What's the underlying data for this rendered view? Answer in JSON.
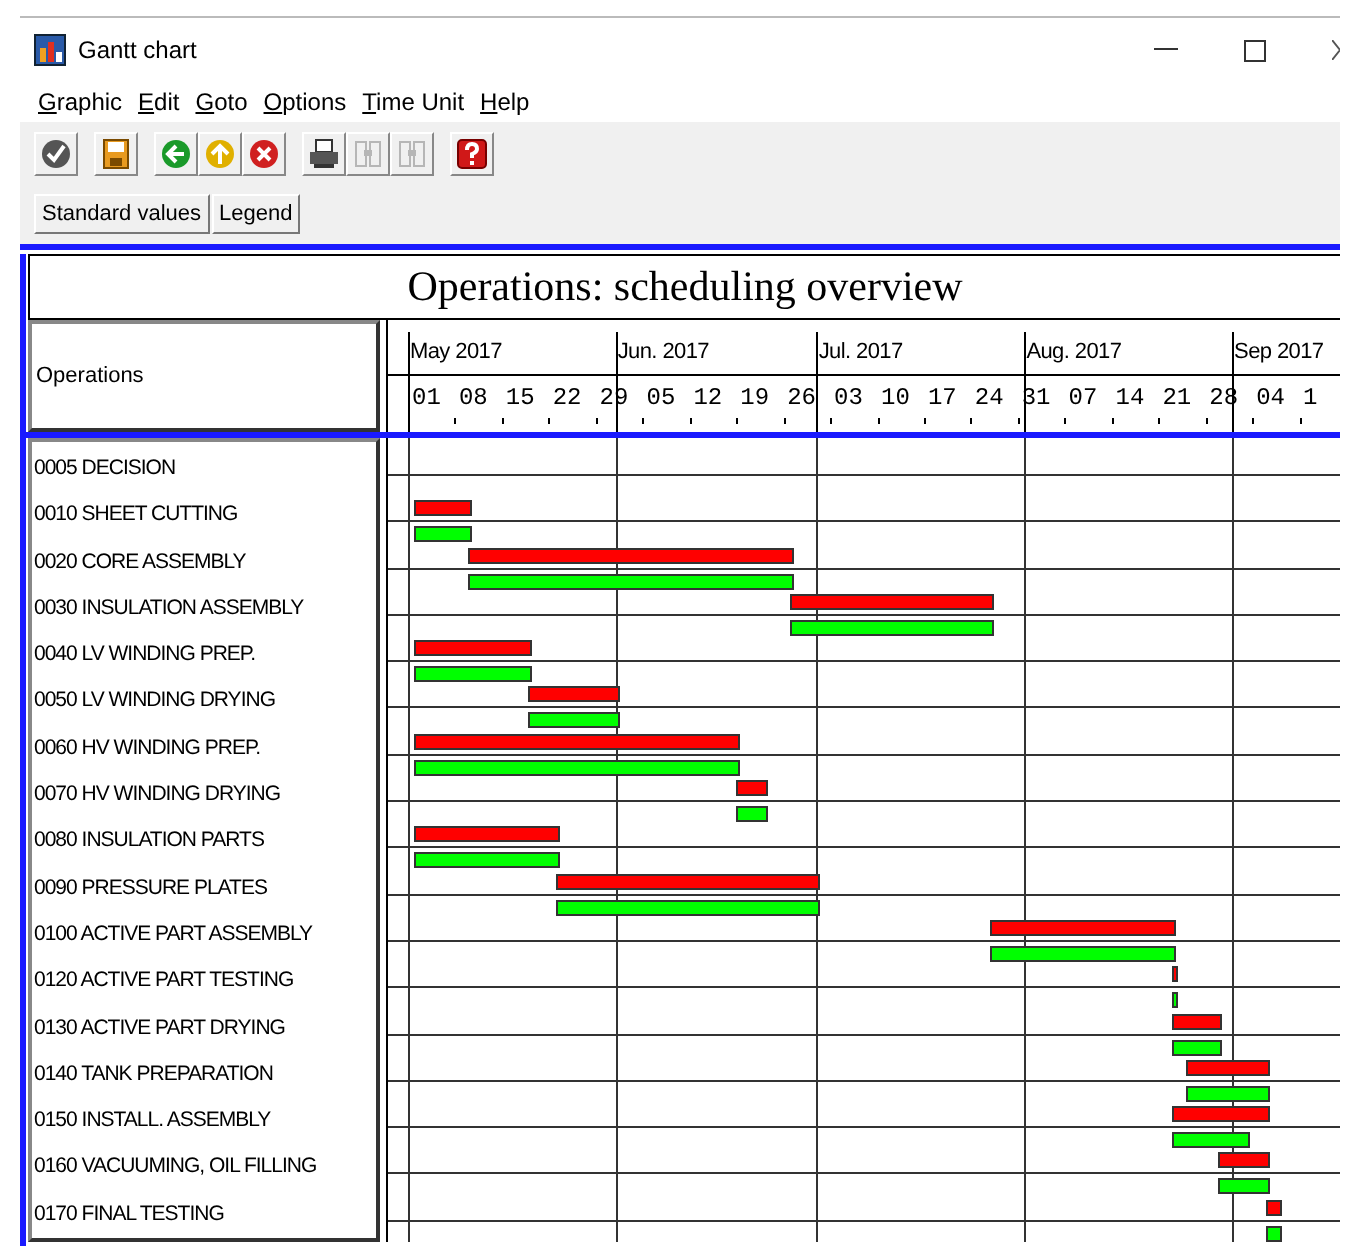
{
  "window": {
    "title": "Gantt chart"
  },
  "menu": [
    "Graphic",
    "Edit",
    "Goto",
    "Options",
    "Time Unit",
    "Help"
  ],
  "toolbar": [
    {
      "kind": "check",
      "disabled": false
    },
    {
      "kind": "save",
      "disabled": false
    },
    {
      "kind": "back",
      "disabled": false
    },
    {
      "kind": "up",
      "disabled": false
    },
    {
      "kind": "cancel",
      "disabled": false
    },
    {
      "kind": "print",
      "disabled": false
    },
    {
      "kind": "find",
      "disabled": true
    },
    {
      "kind": "find-next",
      "disabled": true
    },
    {
      "kind": "help",
      "disabled": false
    }
  ],
  "buttons": [
    "Standard values",
    "Legend"
  ],
  "chart_title": "Operations: scheduling overview",
  "column_header": "Operations",
  "months": [
    "May 2017",
    "Jun. 2017",
    "Jul. 2017",
    "Aug. 2017",
    "Sep 2017"
  ],
  "days": [
    "01",
    "08",
    "15",
    "22",
    "29",
    "05",
    "12",
    "19",
    "26",
    "03",
    "10",
    "17",
    "24",
    "31",
    "07",
    "14",
    "21",
    "28",
    "04",
    "1"
  ],
  "operations": [
    "0005 DECISION",
    "0010 SHEET CUTTING",
    "0020 CORE ASSEMBLY",
    "0030 INSULATION ASSEMBLY",
    "0040 LV WINDING PREP.",
    "0050 LV WINDING DRYING",
    "0060 HV WINDING PREP.",
    "0070 HV WINDING DRYING",
    "0080 INSULATION PARTS",
    "0090 PRESSURE PLATES",
    "0100 ACTIVE PART ASSEMBLY",
    "0120 ACTIVE PART TESTING",
    "0130 ACTIVE PART DRYING",
    "0140 TANK PREPARATION",
    "0150 INSTALL. ASSEMBLY",
    "0160 VACUUMING, OIL FILLING",
    "0170 FINAL TESTING"
  ]
}
